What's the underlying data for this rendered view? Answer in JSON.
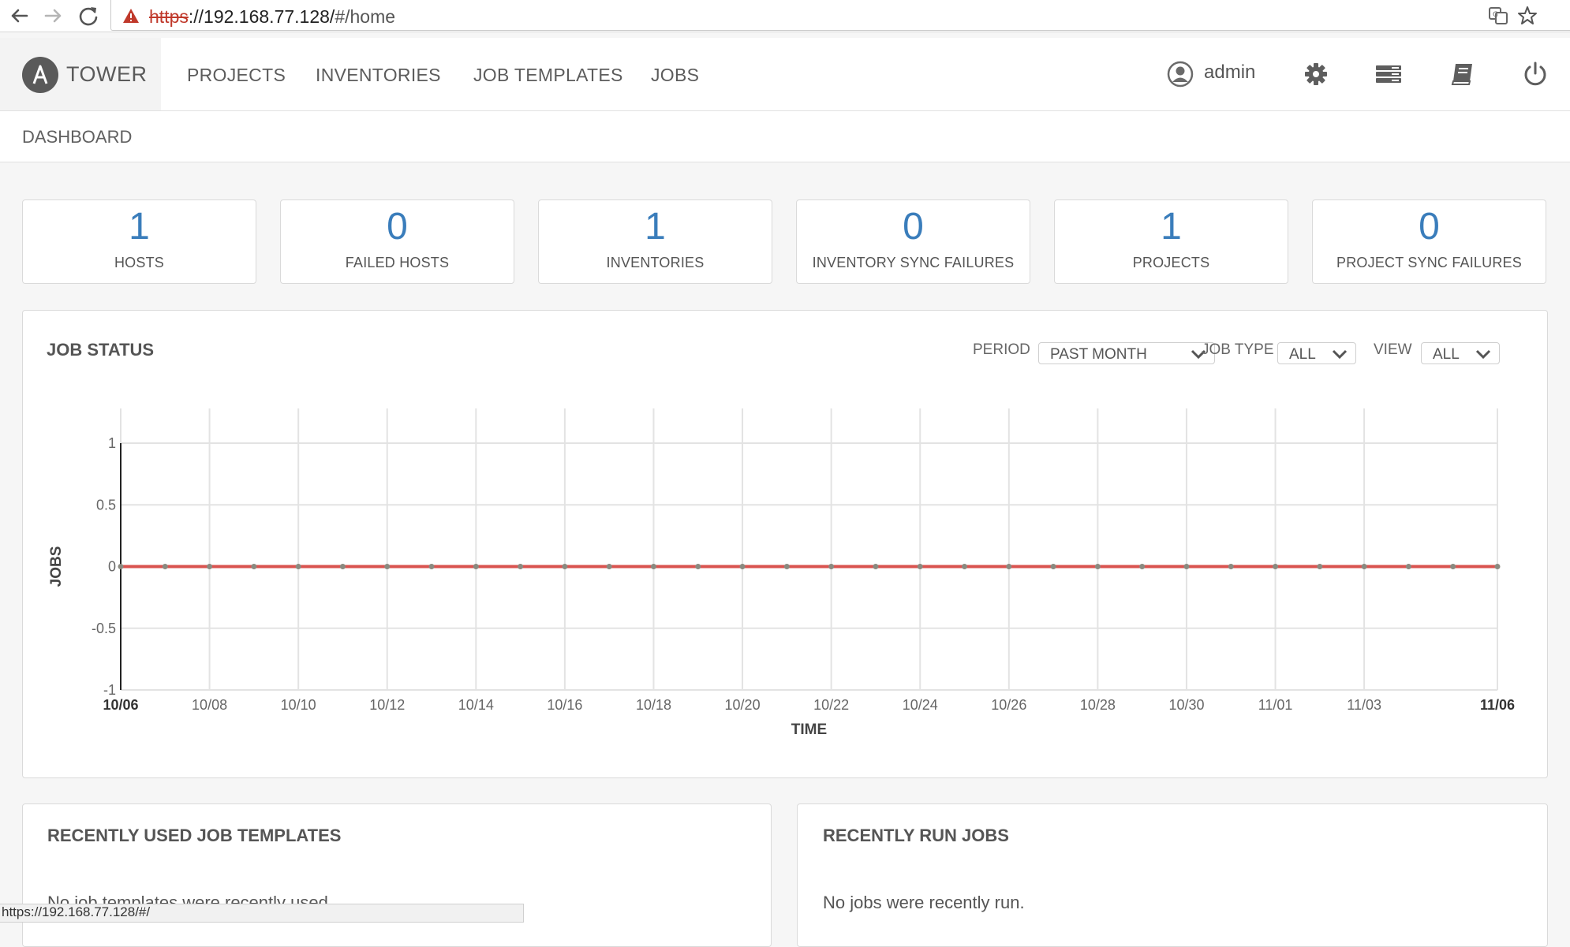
{
  "browser": {
    "url_scheme": "https",
    "url_rest": "://192.168.77.128/",
    "url_hash": "#/home"
  },
  "header": {
    "brand": "TOWER",
    "nav": [
      "PROJECTS",
      "INVENTORIES",
      "JOB TEMPLATES",
      "JOBS"
    ],
    "user": "admin"
  },
  "breadcrumb": "DASHBOARD",
  "counts": [
    {
      "value": "1",
      "label": "HOSTS"
    },
    {
      "value": "0",
      "label": "FAILED HOSTS"
    },
    {
      "value": "1",
      "label": "INVENTORIES"
    },
    {
      "value": "0",
      "label": "INVENTORY SYNC FAILURES"
    },
    {
      "value": "1",
      "label": "PROJECTS"
    },
    {
      "value": "0",
      "label": "PROJECT SYNC FAILURES"
    }
  ],
  "job_status": {
    "title": "JOB STATUS",
    "filters": {
      "period_label": "PERIOD",
      "period_value": "PAST MONTH",
      "job_type_label": "JOB TYPE",
      "job_type_value": "ALL",
      "view_label": "VIEW",
      "view_value": "ALL"
    }
  },
  "chart_data": {
    "type": "line",
    "title": "",
    "xlabel": "TIME",
    "ylabel": "JOBS",
    "ylim": [
      -1,
      1
    ],
    "yticks": [
      "1",
      "0.5",
      "0",
      "-0.5",
      "-1"
    ],
    "xticks": [
      "10/06",
      "10/08",
      "10/10",
      "10/12",
      "10/14",
      "10/16",
      "10/18",
      "10/20",
      "10/22",
      "10/24",
      "10/26",
      "10/28",
      "10/30",
      "11/01",
      "11/03",
      "11/06"
    ],
    "x": [
      "10/06",
      "10/07",
      "10/08",
      "10/09",
      "10/10",
      "10/11",
      "10/12",
      "10/13",
      "10/14",
      "10/15",
      "10/16",
      "10/17",
      "10/18",
      "10/19",
      "10/20",
      "10/21",
      "10/22",
      "10/23",
      "10/24",
      "10/25",
      "10/26",
      "10/27",
      "10/28",
      "10/29",
      "10/30",
      "10/31",
      "11/01",
      "11/02",
      "11/03",
      "11/04",
      "11/05",
      "11/06"
    ],
    "series": [
      {
        "values": [
          0,
          0,
          0,
          0,
          0,
          0,
          0,
          0,
          0,
          0,
          0,
          0,
          0,
          0,
          0,
          0,
          0,
          0,
          0,
          0,
          0,
          0,
          0,
          0,
          0,
          0,
          0,
          0,
          0,
          0,
          0,
          0
        ],
        "color": "#d9534f"
      }
    ],
    "grid": true,
    "legend": "none"
  },
  "recent_templates": {
    "title": "RECENTLY USED JOB TEMPLATES",
    "empty": "No job templates were recently used."
  },
  "recent_jobs": {
    "title": "RECENTLY RUN JOBS",
    "empty": "No jobs were recently run."
  },
  "status_bar": "https://192.168.77.128/#/"
}
